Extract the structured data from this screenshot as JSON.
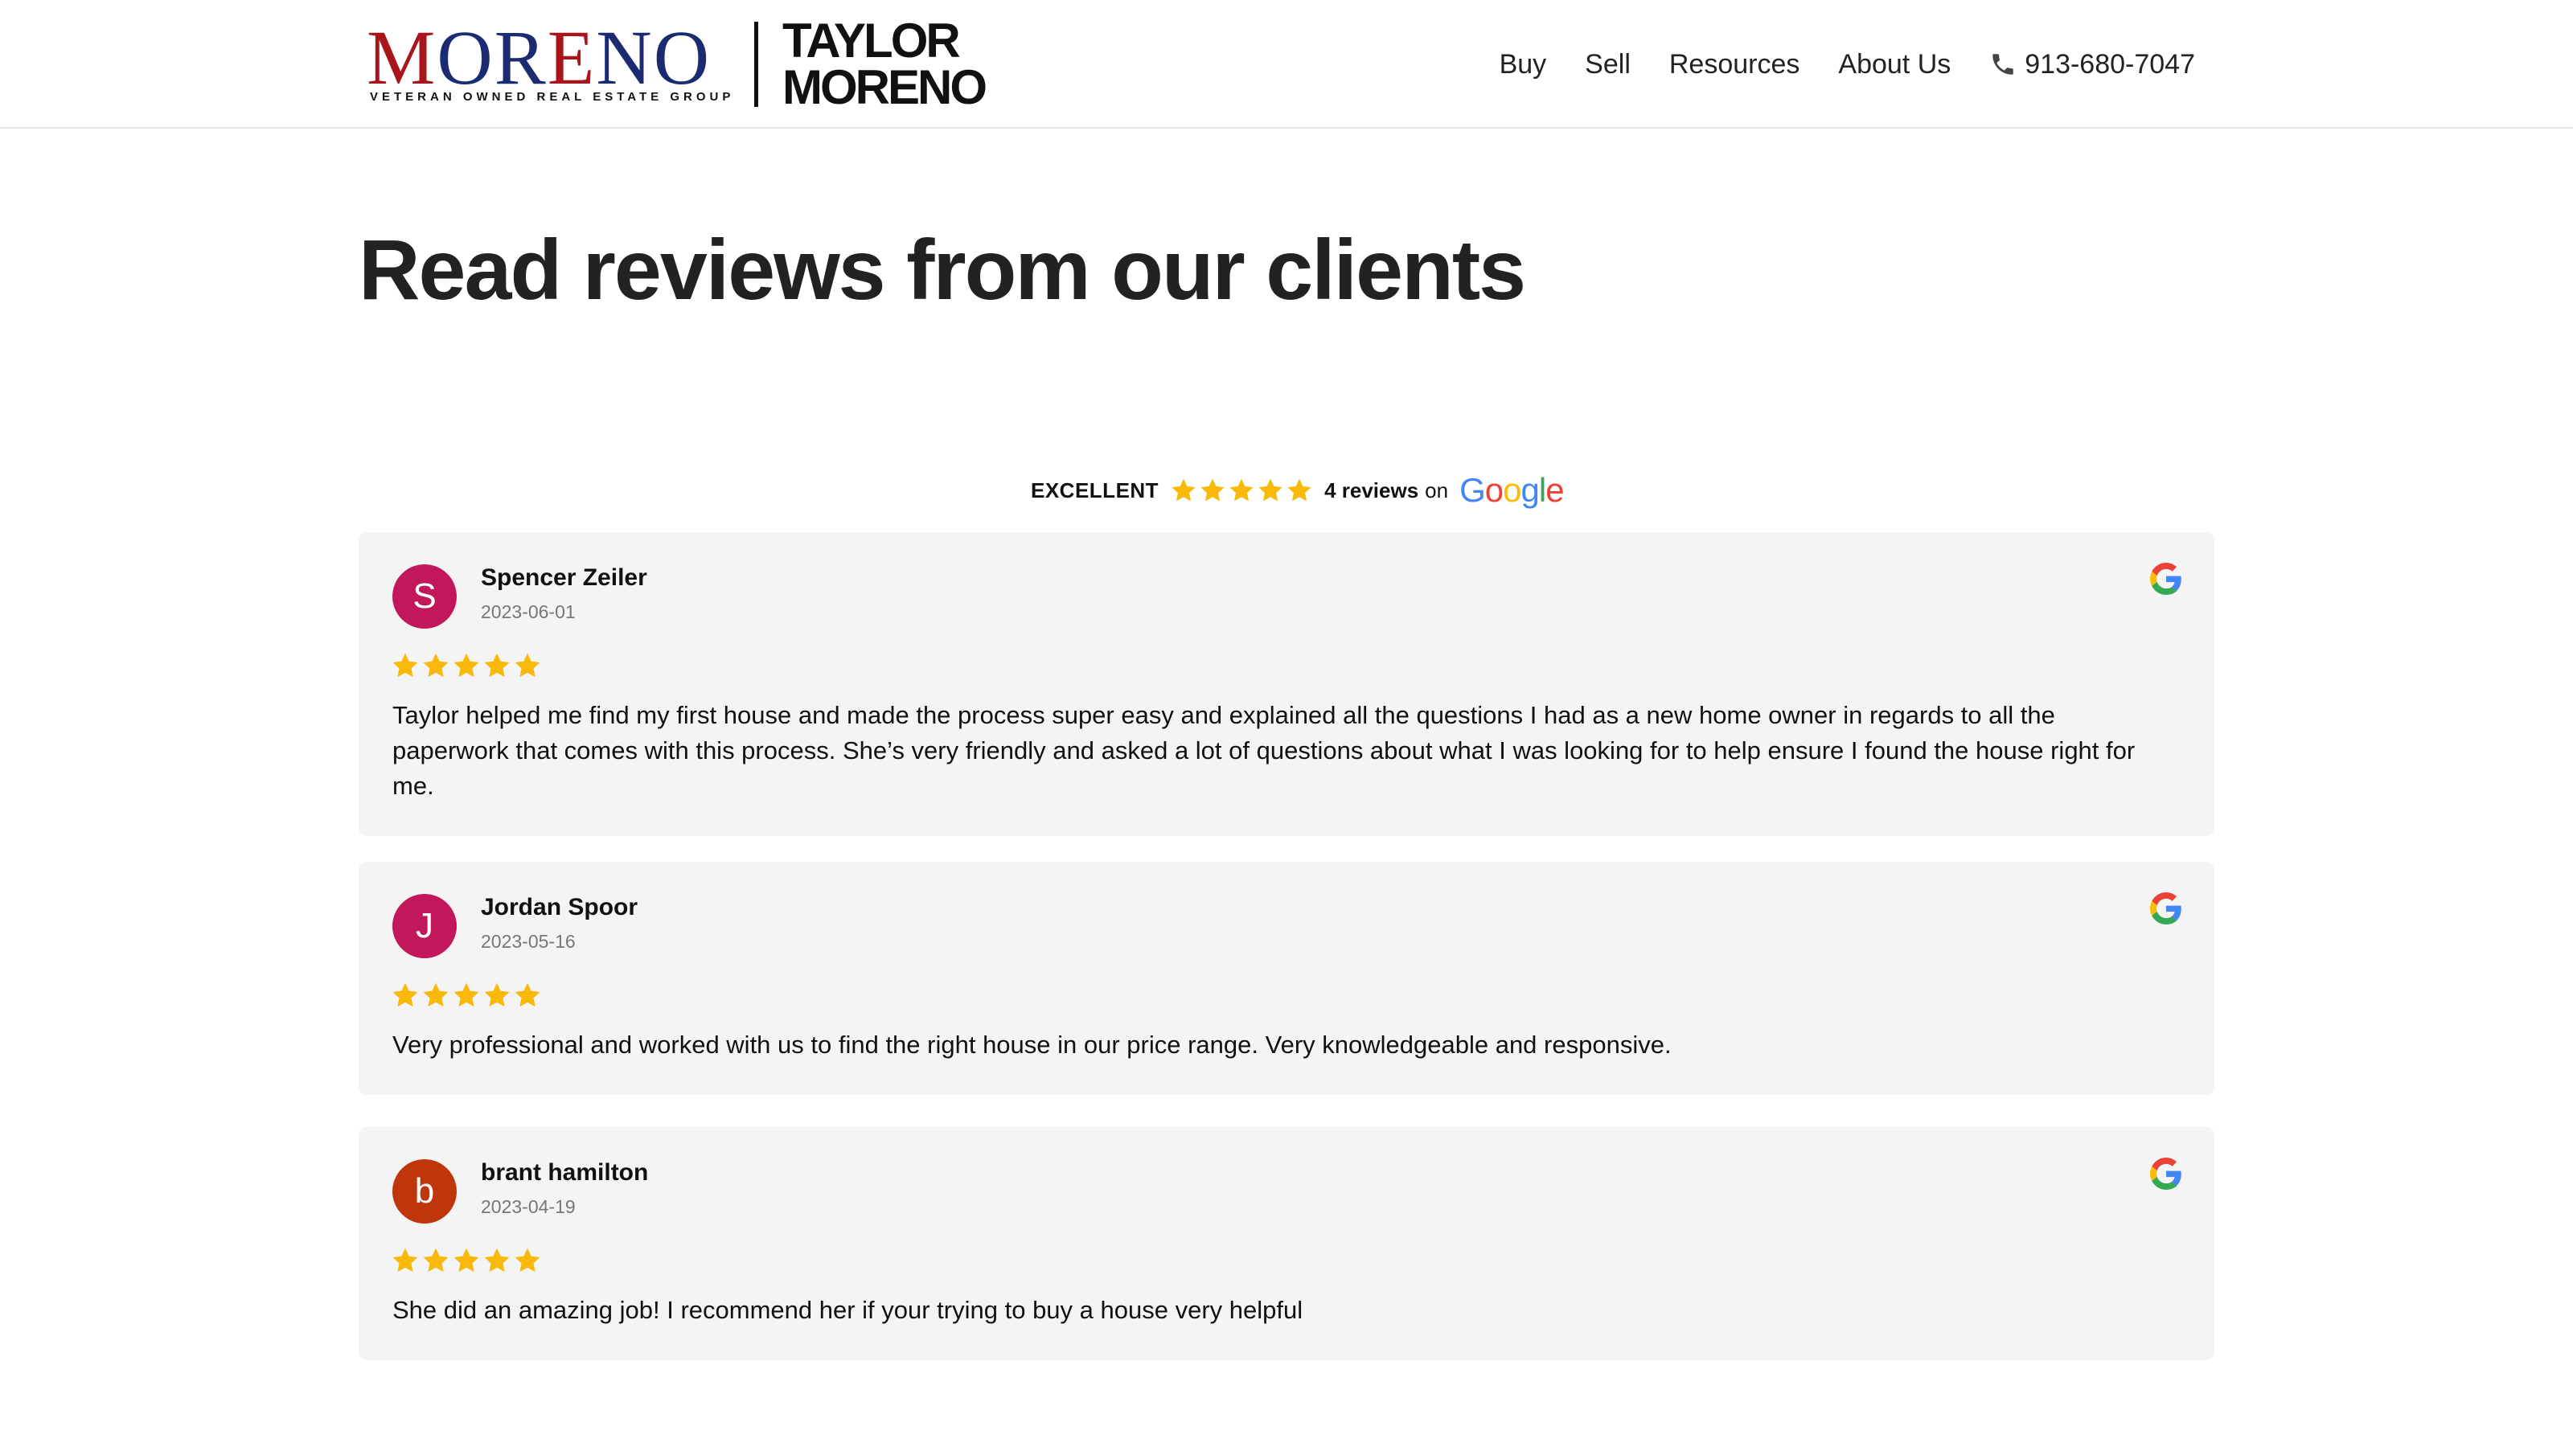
{
  "header": {
    "logo": {
      "word_red_1": "M",
      "word_blue": "OR",
      "word_red_2": "E",
      "word_blue_2": "NO",
      "tagline": "VETERAN OWNED REAL ESTATE GROUP",
      "name_line1": "TAYLOR",
      "name_line2": "MORENO"
    },
    "nav": {
      "buy": "Buy",
      "sell": "Sell",
      "resources": "Resources",
      "about": "About Us",
      "phone": "913-680-7047"
    }
  },
  "page": {
    "title": "Read reviews from our clients"
  },
  "summary": {
    "rating_label": "EXCELLENT",
    "stars": 5,
    "count_label": "4 reviews",
    "on_label": "on",
    "source": "Google"
  },
  "reviews": [
    {
      "initial": "S",
      "author": "Spencer Zeiler",
      "date": "2023-06-01",
      "stars": 5,
      "avatar_color": "#c2185b",
      "text": "Taylor helped me find my first house and made the process super easy and explained all the questions I had as a new home owner in regards to all the paperwork that comes with this process. She’s very friendly and asked a lot of questions about what I was looking for to help ensure I found the house right for me."
    },
    {
      "initial": "J",
      "author": "Jordan Spoor",
      "date": "2023-05-16",
      "stars": 5,
      "avatar_color": "#c2185b",
      "text": "Very professional and worked with us to find the right house in our price range. Very knowledgeable and responsive."
    },
    {
      "initial": "b",
      "author": "brant hamilton",
      "date": "2023-04-19",
      "stars": 5,
      "avatar_color": "#bf360c",
      "text": "She did an amazing job! I recommend her if your trying to buy a house very helpful"
    }
  ],
  "colors": {
    "star": "#f8b90a",
    "brand_red": "#a8161c",
    "brand_blue": "#1b2b72",
    "card_bg": "#f4f4f4"
  }
}
